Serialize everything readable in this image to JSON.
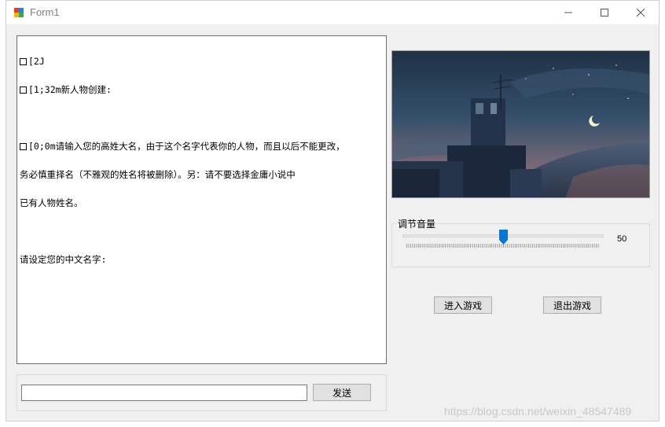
{
  "window": {
    "title": "Form1"
  },
  "console": {
    "lines": [
      {
        "prefix_box": true,
        "text": "[2J"
      },
      {
        "prefix_box": true,
        "text": "[1;32m新人物创建:"
      },
      {
        "prefix_box": false,
        "text": ""
      },
      {
        "prefix_box": true,
        "text": "[0;0m请输入您的高姓大名，由于这个名字代表你的人物，而且以后不能更改，"
      },
      {
        "prefix_box": false,
        "text": "务必慎重择名（不雅观的姓名将被删除）。另：请不要选择金庸小说中"
      },
      {
        "prefix_box": false,
        "text": "已有人物姓名。"
      },
      {
        "prefix_box": false,
        "text": ""
      },
      {
        "prefix_box": false,
        "text": "请设定您的中文名字:"
      }
    ]
  },
  "message_input": {
    "value": ""
  },
  "send_button": {
    "label": "发送"
  },
  "volume": {
    "label": "调节音量",
    "value": "50",
    "level": 0.5
  },
  "enter_button": {
    "label": "进入游戏"
  },
  "exit_button": {
    "label": "退出游戏"
  },
  "watermark": {
    "text": "https://blog.csdn.net/weixin_48547489"
  },
  "colors": {
    "slider_thumb": "#0078d7",
    "window_bg": "#f0f0f0"
  },
  "icons": {
    "app": "winforms-app-icon",
    "minimize": "minimize-icon",
    "maximize": "maximize-icon",
    "close": "close-icon"
  }
}
